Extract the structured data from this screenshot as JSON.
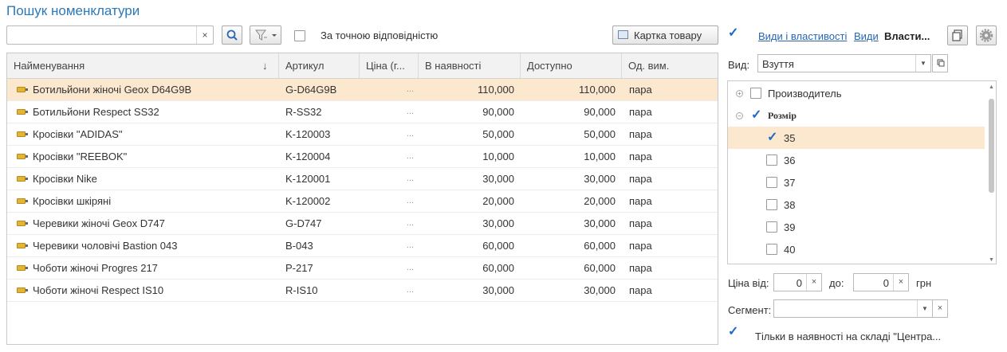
{
  "page_title": "Пошук номенклатури",
  "search": {
    "value": "",
    "placeholder": "",
    "clear_glyph": "×"
  },
  "toolbar": {
    "find_icon": "search-icon",
    "filter_icon": "filter-icon",
    "exact_match_label": "За точною відповідністю",
    "exact_match_checked": false,
    "card_button_label": "Картка товару"
  },
  "table": {
    "columns": [
      "Найменування",
      "Артикул",
      "Ціна (г...",
      "В наявності",
      "Доступно",
      "Од. вим."
    ],
    "sort_glyph": "↓",
    "rows": [
      {
        "name": "Ботильйони  жіночі Geox D64G9B",
        "article": "G-D64G9B",
        "price": "...",
        "in_stock": "110,000",
        "available": "110,000",
        "unit": "пара",
        "selected": true
      },
      {
        "name": "Ботильйони Respect SS32",
        "article": "R-SS32",
        "price": "...",
        "in_stock": "90,000",
        "available": "90,000",
        "unit": "пара"
      },
      {
        "name": "Кросівки \"ADIDAS\"",
        "article": "K-120003",
        "price": "...",
        "in_stock": "50,000",
        "available": "50,000",
        "unit": "пара"
      },
      {
        "name": "Кросівки \"REEBOK\"",
        "article": "K-120004",
        "price": "...",
        "in_stock": "10,000",
        "available": "10,000",
        "unit": "пара"
      },
      {
        "name": "Кросівки Nike",
        "article": "K-120001",
        "price": "...",
        "in_stock": "30,000",
        "available": "30,000",
        "unit": "пара"
      },
      {
        "name": "Кросівки шкіряні",
        "article": "K-120002",
        "price": "...",
        "in_stock": "20,000",
        "available": "20,000",
        "unit": "пара"
      },
      {
        "name": "Черевики жіночі Geox D747",
        "article": "G-D747",
        "price": "...",
        "in_stock": "30,000",
        "available": "30,000",
        "unit": "пара"
      },
      {
        "name": "Черевики чоловічі Bastion 043",
        "article": "B-043",
        "price": "...",
        "in_stock": "60,000",
        "available": "60,000",
        "unit": "пара"
      },
      {
        "name": "Чоботи жіночі Progres 217",
        "article": "P-217",
        "price": "...",
        "in_stock": "60,000",
        "available": "60,000",
        "unit": "пара"
      },
      {
        "name": "Чоботи жіночі Respect IS10",
        "article": "R-IS10",
        "price": "...",
        "in_stock": "30,000",
        "available": "30,000",
        "unit": "пара"
      }
    ]
  },
  "panel": {
    "panel_checked": true,
    "link_kinds_props": "Види і властивості",
    "link_kinds": "Види",
    "tab_props": "Власти...",
    "vid_label": "Вид:",
    "vid_value": "Взуття",
    "tree": [
      {
        "label": "Производитель",
        "level": 0,
        "expander": "+",
        "checked": false
      },
      {
        "label": "Розмір",
        "level": 0,
        "expander": "−",
        "checked": true,
        "bold": true
      },
      {
        "label": "35",
        "level": 1,
        "checked": true,
        "selected": true
      },
      {
        "label": "36",
        "level": 1,
        "checked": false
      },
      {
        "label": "37",
        "level": 1,
        "checked": false
      },
      {
        "label": "38",
        "level": 1,
        "checked": false
      },
      {
        "label": "39",
        "level": 1,
        "checked": false
      },
      {
        "label": "40",
        "level": 1,
        "checked": false
      }
    ],
    "price_from_label": "Ціна від:",
    "price_from_value": "0",
    "price_to_label": "до:",
    "price_to_value": "0",
    "currency": "грн",
    "segment_label": "Сегмент:",
    "segment_value": "",
    "in_stock_checked": true,
    "in_stock_label": "Тільки в наявності на складі \"Центра..."
  },
  "colors": {
    "accent": "#2b78b8",
    "selection": "#fbe8cf",
    "check": "#2268c9"
  }
}
